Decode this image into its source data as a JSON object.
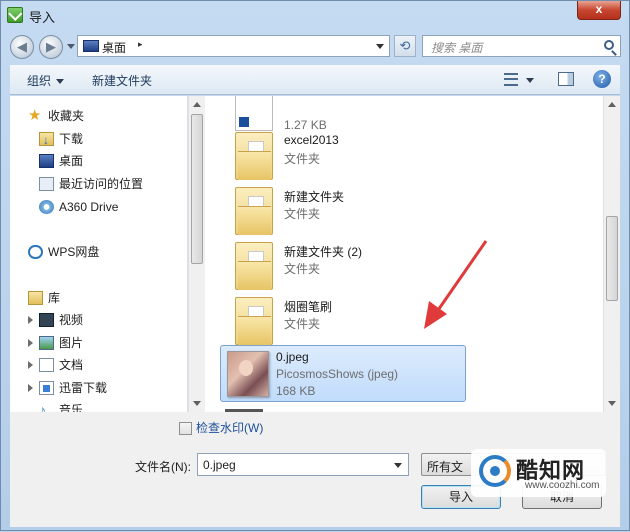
{
  "window": {
    "title": "导入",
    "close_label": "x"
  },
  "address": {
    "path_label": "桌面",
    "separator": "▸"
  },
  "search": {
    "placeholder": "搜索 桌面"
  },
  "toolbar": {
    "organize_label": "组织",
    "new_folder_label": "新建文件夹",
    "help_label": "?"
  },
  "sidebar": {
    "favorites_label": "收藏夹",
    "favorites": [
      {
        "label": "下载",
        "icon": "download-folder-icon"
      },
      {
        "label": "桌面",
        "icon": "desktop-icon"
      },
      {
        "label": "最近访问的位置",
        "icon": "recent-places-icon"
      },
      {
        "label": "A360 Drive",
        "icon": "a360-drive-icon"
      }
    ],
    "wps_label": "WPS网盘",
    "library_label": "库",
    "libraries": [
      {
        "label": "视频",
        "icon": "video-library-icon"
      },
      {
        "label": "图片",
        "icon": "pictures-library-icon"
      },
      {
        "label": "文档",
        "icon": "documents-library-icon"
      },
      {
        "label": "迅雷下载",
        "icon": "xunlei-download-icon"
      },
      {
        "label": "音乐",
        "icon": "music-library-icon"
      }
    ]
  },
  "files": [
    {
      "name": "",
      "type": "",
      "size": "1.27 KB"
    },
    {
      "name": "excel2013",
      "type": "文件夹"
    },
    {
      "name": "新建文件夹",
      "type": "文件夹"
    },
    {
      "name": "新建文件夹 (2)",
      "type": "文件夹"
    },
    {
      "name": "烟圈笔刷",
      "type": "文件夹"
    },
    {
      "name": "0.jpeg",
      "type": "PicosmosShows (jpeg)",
      "size": "168 KB",
      "selected": true
    }
  ],
  "bottom": {
    "watermark_checkbox_label": "检查水印(W)",
    "filename_label": "文件名(N):",
    "filename_value": "0.jpeg",
    "filetype_value": "所有文",
    "open_button_label": "导入",
    "cancel_button_label": "取消"
  },
  "watermark": {
    "brand": "酷知网",
    "url": "www.coozhi.com"
  },
  "colors": {
    "selection": "#c1dcfc",
    "annotation_arrow": "#e03a3a",
    "link_blue": "#1e4f9c"
  }
}
